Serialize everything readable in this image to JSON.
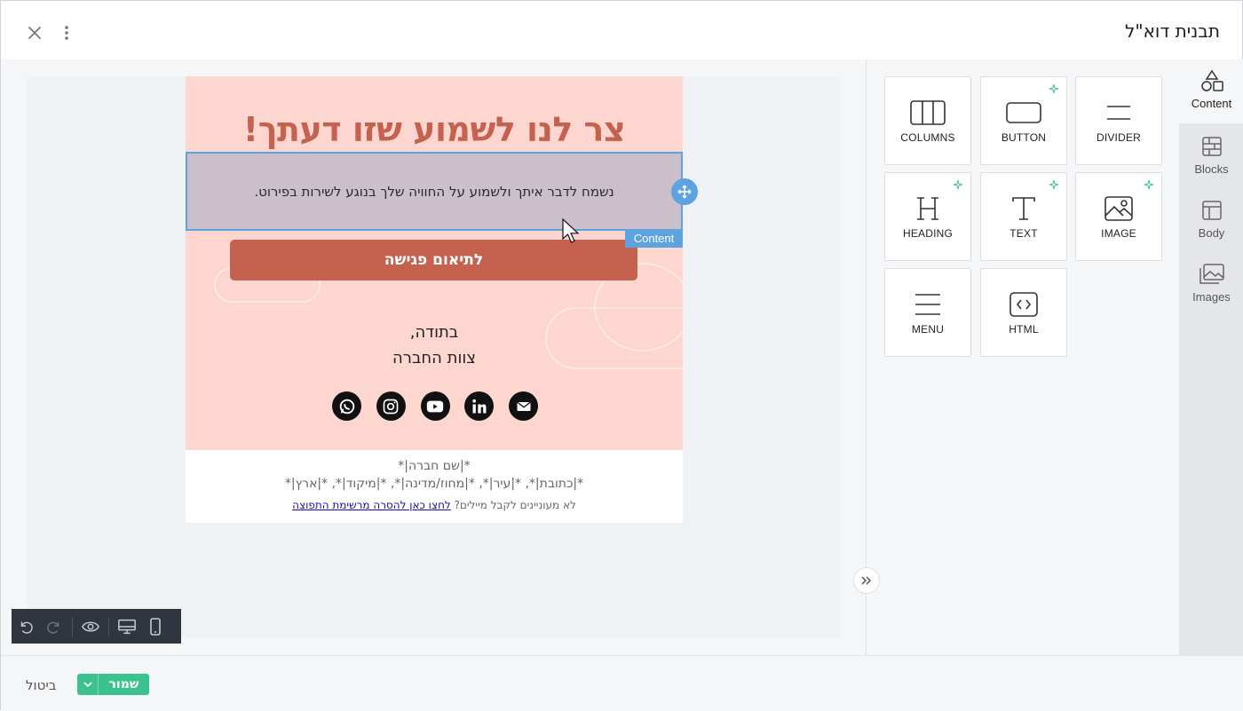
{
  "header": {
    "title": "תבנית דוא\"ל"
  },
  "email": {
    "heading": "צר לנו לשמוע שזו דעתך!",
    "body_text": "נשמח לדבר איתך ולשמוע על החוויה שלך בנוגע לשירות בפירוט.",
    "content_tag": "Content",
    "cta_label": "לתיאום פגישה",
    "signoff_line1": "בתודה,",
    "signoff_line2": "צוות החברה",
    "socials": [
      "whatsapp-icon",
      "instagram-icon",
      "youtube-icon",
      "linkedin-icon",
      "email-icon"
    ],
    "footer": {
      "company": "*|שם חברה|*",
      "address": "*|כתובת|*, *|עיר|*, *|מחוז/מדינה|*, *|מיקוד|*, *|ארץ|*",
      "unsubscribe_prefix": "לא מעוניינים לקבל מיילים?",
      "unsubscribe_link": "לחצו כאן להסרה מרשימת התפוצה"
    },
    "colors": {
      "background": "#fdd6d0",
      "heading": "#c5614f",
      "button": "#c5614f",
      "selection": "#5da3e0"
    }
  },
  "toolbar": {
    "items": [
      "undo-icon",
      "redo-icon",
      "preview-icon",
      "desktop-icon",
      "mobile-icon"
    ]
  },
  "tiles": [
    {
      "label": "COLUMNS",
      "icon": "columns-icon",
      "ai": false
    },
    {
      "label": "BUTTON",
      "icon": "button-icon",
      "ai": true
    },
    {
      "label": "DIVIDER",
      "icon": "divider-icon",
      "ai": false
    },
    {
      "label": "HEADING",
      "icon": "heading-icon",
      "ai": true
    },
    {
      "label": "TEXT",
      "icon": "text-icon",
      "ai": true
    },
    {
      "label": "IMAGE",
      "icon": "image-icon",
      "ai": true
    },
    {
      "label": "MENU",
      "icon": "menu-icon",
      "ai": false
    },
    {
      "label": "HTML",
      "icon": "html-icon",
      "ai": false
    }
  ],
  "sidetabs": [
    {
      "label": "Content",
      "active": true
    },
    {
      "label": "Blocks",
      "active": false
    },
    {
      "label": "Body",
      "active": false
    },
    {
      "label": "Images",
      "active": false
    }
  ],
  "footer_bar": {
    "save_label": "שמור",
    "cancel_label": "ביטול",
    "save_color": "#3cc28f"
  }
}
